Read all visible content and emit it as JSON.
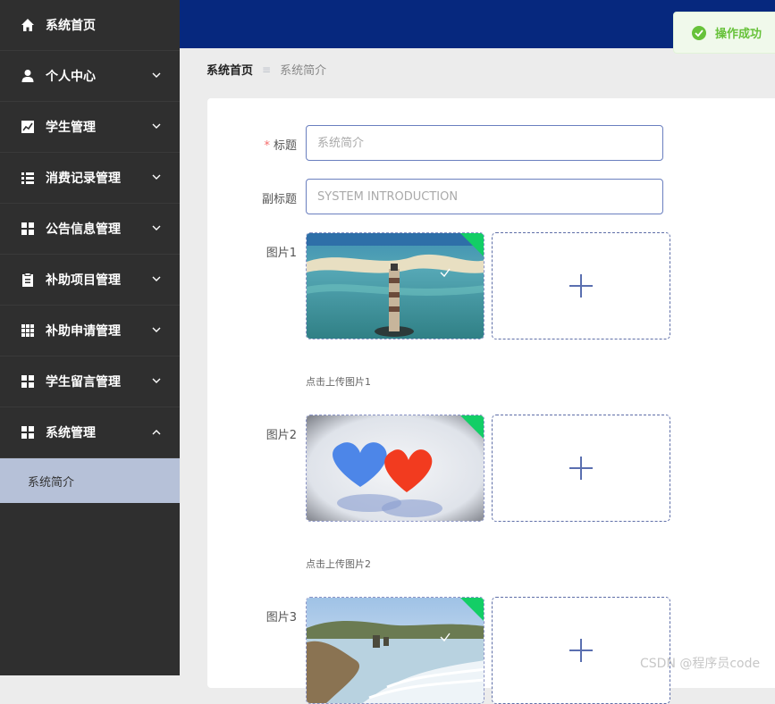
{
  "sidebar": {
    "items": [
      {
        "label": "系统首页",
        "icon": "home-icon"
      },
      {
        "label": "个人中心",
        "icon": "user-icon"
      },
      {
        "label": "学生管理",
        "icon": "chart-icon"
      },
      {
        "label": "消费记录管理",
        "icon": "list-icon"
      },
      {
        "label": "公告信息管理",
        "icon": "grid-icon"
      },
      {
        "label": "补助项目管理",
        "icon": "clipboard-icon"
      },
      {
        "label": "补助申请管理",
        "icon": "table-icon"
      },
      {
        "label": "学生留言管理",
        "icon": "grid-icon"
      },
      {
        "label": "系统管理",
        "icon": "grid-icon"
      }
    ],
    "submenu": {
      "label": "系统简介"
    }
  },
  "toast": {
    "text": "操作成功",
    "color": "#67c23a"
  },
  "breadcrumb": {
    "home": "系统首页",
    "separator": "≡",
    "current": "系统简介"
  },
  "form": {
    "title": {
      "label": "标题",
      "required_mark": "*",
      "placeholder": "系统简介"
    },
    "subtitle": {
      "label": "副标题",
      "placeholder": "SYSTEM INTRODUCTION"
    },
    "images": [
      {
        "label": "图片1",
        "hint": "点击上传图片1"
      },
      {
        "label": "图片2",
        "hint": "点击上传图片2"
      },
      {
        "label": "图片3"
      }
    ]
  },
  "watermark": "CSDN @程序员code",
  "colors": {
    "sidebar": "#2f2f2f",
    "header": "#06287e",
    "active_submenu": "#b6c1d8",
    "accent": "#5a6fb0"
  }
}
